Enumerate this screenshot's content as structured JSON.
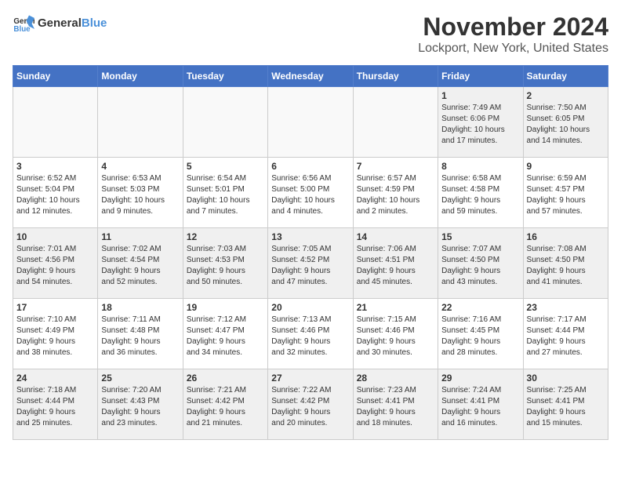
{
  "header": {
    "logo_general": "General",
    "logo_blue": "Blue",
    "month_title": "November 2024",
    "location": "Lockport, New York, United States"
  },
  "weekdays": [
    "Sunday",
    "Monday",
    "Tuesday",
    "Wednesday",
    "Thursday",
    "Friday",
    "Saturday"
  ],
  "weeks": [
    [
      {
        "day": "",
        "info": "",
        "empty": true
      },
      {
        "day": "",
        "info": "",
        "empty": true
      },
      {
        "day": "",
        "info": "",
        "empty": true
      },
      {
        "day": "",
        "info": "",
        "empty": true
      },
      {
        "day": "",
        "info": "",
        "empty": true
      },
      {
        "day": "1",
        "info": "Sunrise: 7:49 AM\nSunset: 6:06 PM\nDaylight: 10 hours\nand 17 minutes.",
        "empty": false
      },
      {
        "day": "2",
        "info": "Sunrise: 7:50 AM\nSunset: 6:05 PM\nDaylight: 10 hours\nand 14 minutes.",
        "empty": false
      }
    ],
    [
      {
        "day": "3",
        "info": "Sunrise: 6:52 AM\nSunset: 5:04 PM\nDaylight: 10 hours\nand 12 minutes.",
        "empty": false
      },
      {
        "day": "4",
        "info": "Sunrise: 6:53 AM\nSunset: 5:03 PM\nDaylight: 10 hours\nand 9 minutes.",
        "empty": false
      },
      {
        "day": "5",
        "info": "Sunrise: 6:54 AM\nSunset: 5:01 PM\nDaylight: 10 hours\nand 7 minutes.",
        "empty": false
      },
      {
        "day": "6",
        "info": "Sunrise: 6:56 AM\nSunset: 5:00 PM\nDaylight: 10 hours\nand 4 minutes.",
        "empty": false
      },
      {
        "day": "7",
        "info": "Sunrise: 6:57 AM\nSunset: 4:59 PM\nDaylight: 10 hours\nand 2 minutes.",
        "empty": false
      },
      {
        "day": "8",
        "info": "Sunrise: 6:58 AM\nSunset: 4:58 PM\nDaylight: 9 hours\nand 59 minutes.",
        "empty": false
      },
      {
        "day": "9",
        "info": "Sunrise: 6:59 AM\nSunset: 4:57 PM\nDaylight: 9 hours\nand 57 minutes.",
        "empty": false
      }
    ],
    [
      {
        "day": "10",
        "info": "Sunrise: 7:01 AM\nSunset: 4:56 PM\nDaylight: 9 hours\nand 54 minutes.",
        "empty": false
      },
      {
        "day": "11",
        "info": "Sunrise: 7:02 AM\nSunset: 4:54 PM\nDaylight: 9 hours\nand 52 minutes.",
        "empty": false
      },
      {
        "day": "12",
        "info": "Sunrise: 7:03 AM\nSunset: 4:53 PM\nDaylight: 9 hours\nand 50 minutes.",
        "empty": false
      },
      {
        "day": "13",
        "info": "Sunrise: 7:05 AM\nSunset: 4:52 PM\nDaylight: 9 hours\nand 47 minutes.",
        "empty": false
      },
      {
        "day": "14",
        "info": "Sunrise: 7:06 AM\nSunset: 4:51 PM\nDaylight: 9 hours\nand 45 minutes.",
        "empty": false
      },
      {
        "day": "15",
        "info": "Sunrise: 7:07 AM\nSunset: 4:50 PM\nDaylight: 9 hours\nand 43 minutes.",
        "empty": false
      },
      {
        "day": "16",
        "info": "Sunrise: 7:08 AM\nSunset: 4:50 PM\nDaylight: 9 hours\nand 41 minutes.",
        "empty": false
      }
    ],
    [
      {
        "day": "17",
        "info": "Sunrise: 7:10 AM\nSunset: 4:49 PM\nDaylight: 9 hours\nand 38 minutes.",
        "empty": false
      },
      {
        "day": "18",
        "info": "Sunrise: 7:11 AM\nSunset: 4:48 PM\nDaylight: 9 hours\nand 36 minutes.",
        "empty": false
      },
      {
        "day": "19",
        "info": "Sunrise: 7:12 AM\nSunset: 4:47 PM\nDaylight: 9 hours\nand 34 minutes.",
        "empty": false
      },
      {
        "day": "20",
        "info": "Sunrise: 7:13 AM\nSunset: 4:46 PM\nDaylight: 9 hours\nand 32 minutes.",
        "empty": false
      },
      {
        "day": "21",
        "info": "Sunrise: 7:15 AM\nSunset: 4:46 PM\nDaylight: 9 hours\nand 30 minutes.",
        "empty": false
      },
      {
        "day": "22",
        "info": "Sunrise: 7:16 AM\nSunset: 4:45 PM\nDaylight: 9 hours\nand 28 minutes.",
        "empty": false
      },
      {
        "day": "23",
        "info": "Sunrise: 7:17 AM\nSunset: 4:44 PM\nDaylight: 9 hours\nand 27 minutes.",
        "empty": false
      }
    ],
    [
      {
        "day": "24",
        "info": "Sunrise: 7:18 AM\nSunset: 4:44 PM\nDaylight: 9 hours\nand 25 minutes.",
        "empty": false
      },
      {
        "day": "25",
        "info": "Sunrise: 7:20 AM\nSunset: 4:43 PM\nDaylight: 9 hours\nand 23 minutes.",
        "empty": false
      },
      {
        "day": "26",
        "info": "Sunrise: 7:21 AM\nSunset: 4:42 PM\nDaylight: 9 hours\nand 21 minutes.",
        "empty": false
      },
      {
        "day": "27",
        "info": "Sunrise: 7:22 AM\nSunset: 4:42 PM\nDaylight: 9 hours\nand 20 minutes.",
        "empty": false
      },
      {
        "day": "28",
        "info": "Sunrise: 7:23 AM\nSunset: 4:41 PM\nDaylight: 9 hours\nand 18 minutes.",
        "empty": false
      },
      {
        "day": "29",
        "info": "Sunrise: 7:24 AM\nSunset: 4:41 PM\nDaylight: 9 hours\nand 16 minutes.",
        "empty": false
      },
      {
        "day": "30",
        "info": "Sunrise: 7:25 AM\nSunset: 4:41 PM\nDaylight: 9 hours\nand 15 minutes.",
        "empty": false
      }
    ]
  ]
}
